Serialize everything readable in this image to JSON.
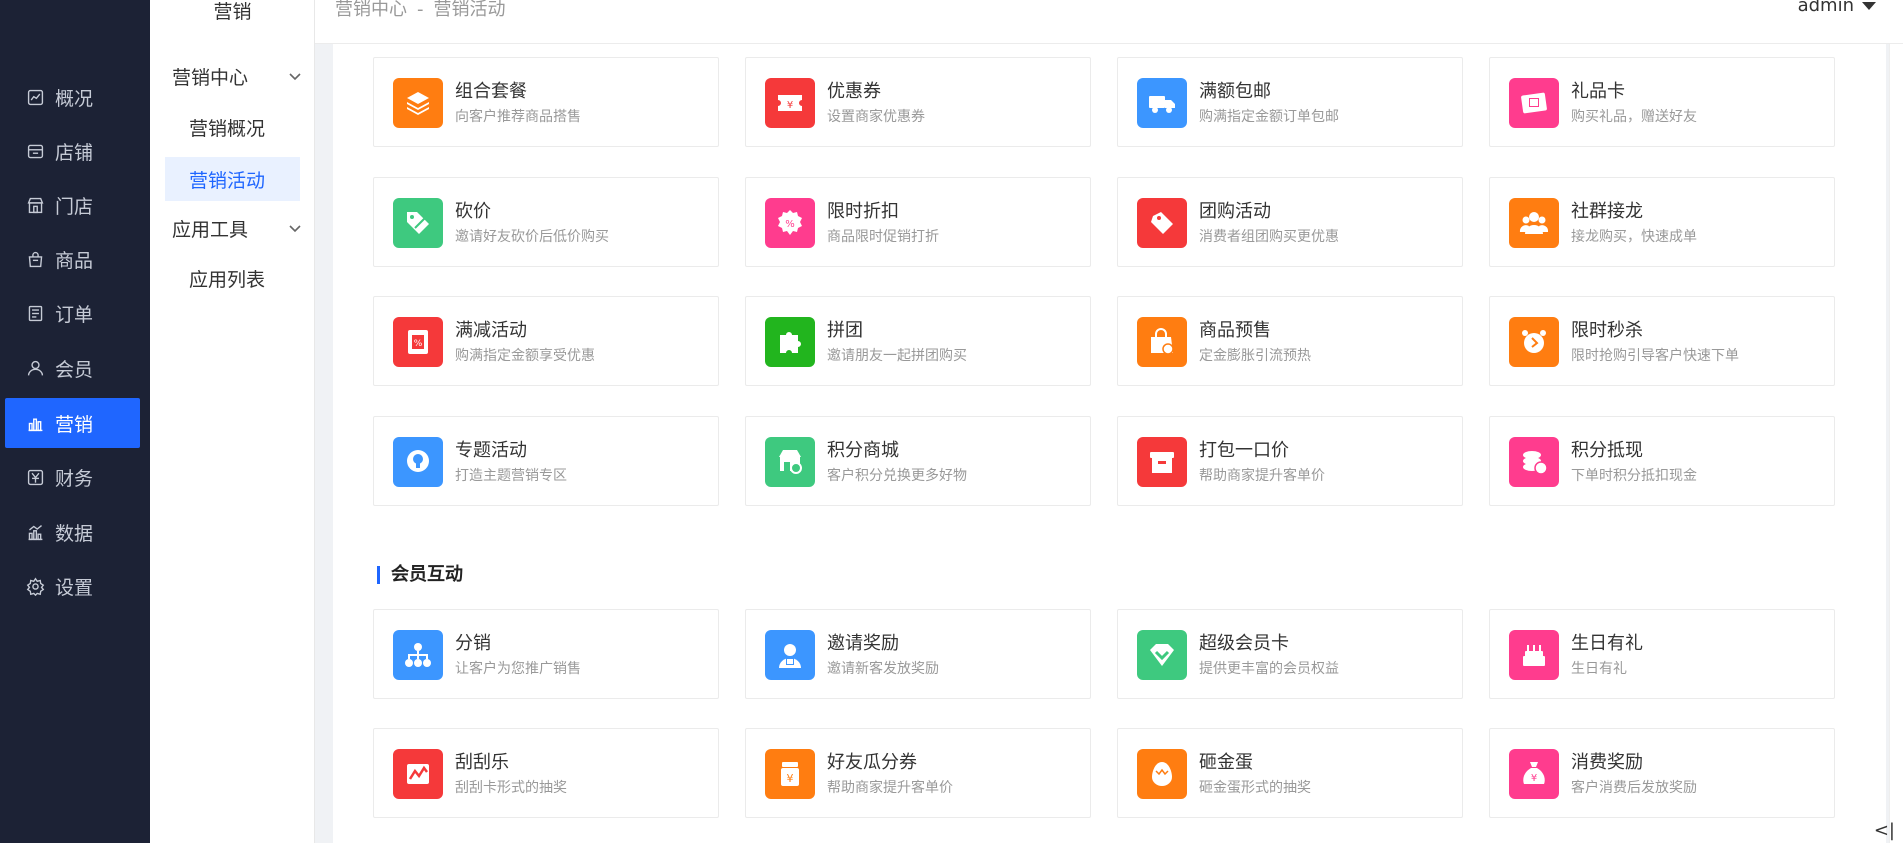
{
  "sidebar": {
    "items": [
      {
        "label": "概况",
        "icon": "chart-icon"
      },
      {
        "label": "店铺",
        "icon": "store-icon"
      },
      {
        "label": "门店",
        "icon": "shop-icon"
      },
      {
        "label": "商品",
        "icon": "bag-icon"
      },
      {
        "label": "订单",
        "icon": "order-icon"
      },
      {
        "label": "会员",
        "icon": "user-icon"
      },
      {
        "label": "营销",
        "icon": "bar-chart-icon"
      },
      {
        "label": "财务",
        "icon": "yen-icon"
      },
      {
        "label": "数据",
        "icon": "data-icon"
      },
      {
        "label": "设置",
        "icon": "gear-icon"
      }
    ],
    "active_index": 6
  },
  "subnav": {
    "title": "营销",
    "group1": "营销中心",
    "group1_items": [
      "营销概况",
      "营销活动"
    ],
    "group2": "应用工具",
    "group2_items": [
      "应用列表"
    ]
  },
  "header": {
    "crumb1": "营销中心",
    "sep": "-",
    "crumb2": "营销活动",
    "user": "admin"
  },
  "activities": [
    {
      "title": "组合套餐",
      "desc": "向客户推荐商品搭售",
      "color": "#ff7d11",
      "icon": "layers-icon"
    },
    {
      "title": "优惠券",
      "desc": "设置商家优惠券",
      "color": "#f5393a",
      "icon": "coupon-icon"
    },
    {
      "title": "满额包邮",
      "desc": "购满指定金额订单包邮",
      "color": "#3c96ff",
      "icon": "truck-icon"
    },
    {
      "title": "礼品卡",
      "desc": "购买礼品，赠送好友",
      "color": "#ff3c8e",
      "icon": "gift-card-icon"
    },
    {
      "title": "砍价",
      "desc": "邀请好友砍价后低价购买",
      "color": "#3ec97f",
      "icon": "tag-cut-icon"
    },
    {
      "title": "限时折扣",
      "desc": "商品限时促销打折",
      "color": "#ff3c8e",
      "icon": "discount-icon"
    },
    {
      "title": "团购活动",
      "desc": "消费者组团购买更优惠",
      "color": "#f5393a",
      "icon": "tags-icon"
    },
    {
      "title": "社群接龙",
      "desc": "接龙购买，快速成单",
      "color": "#ff7d11",
      "icon": "group-icon"
    },
    {
      "title": "满减活动",
      "desc": "购满指定金额享受优惠",
      "color": "#f5393a",
      "icon": "percent-ticket-icon"
    },
    {
      "title": "拼团",
      "desc": "邀请朋友一起拼团购买",
      "color": "#22b51e",
      "icon": "puzzle-icon"
    },
    {
      "title": "商品预售",
      "desc": "定金膨胀引流预热",
      "color": "#ff7d11",
      "icon": "presale-icon"
    },
    {
      "title": "限时秒杀",
      "desc": "限时抢购引导客户快速下单",
      "color": "#ff7d11",
      "icon": "alarm-icon"
    },
    {
      "title": "专题活动",
      "desc": "打造主题营销专区",
      "color": "#3c96ff",
      "icon": "bulb-icon"
    },
    {
      "title": "积分商城",
      "desc": "客户积分兑换更多好物",
      "color": "#3ec97f",
      "icon": "points-store-icon"
    },
    {
      "title": "打包一口价",
      "desc": "帮助商家提升客单价",
      "color": "#f5393a",
      "icon": "box-icon"
    },
    {
      "title": "积分抵现",
      "desc": "下单时积分抵扣现金",
      "color": "#ff3c8e",
      "icon": "coins-icon"
    }
  ],
  "member_section": {
    "title": "会员互动",
    "items": [
      {
        "title": "分销",
        "desc": "让客户为您推广销售",
        "color": "#3c96ff",
        "icon": "network-icon"
      },
      {
        "title": "邀请奖励",
        "desc": "邀请新客发放奖励",
        "color": "#3c96ff",
        "icon": "invite-icon"
      },
      {
        "title": "超级会员卡",
        "desc": "提供更丰富的会员权益",
        "color": "#3ec97f",
        "icon": "diamond-icon"
      },
      {
        "title": "生日有礼",
        "desc": "生日有礼",
        "color": "#ff3c8e",
        "icon": "cake-icon"
      },
      {
        "title": "刮刮乐",
        "desc": "刮刮卡形式的抽奖",
        "color": "#f5393a",
        "icon": "scratch-icon"
      },
      {
        "title": "好友瓜分券",
        "desc": "帮助商家提升客单价",
        "color": "#ff7d11",
        "icon": "split-coupon-icon"
      },
      {
        "title": "砸金蛋",
        "desc": "砸金蛋形式的抽奖",
        "color": "#ff7d11",
        "icon": "egg-icon"
      },
      {
        "title": "消费奖励",
        "desc": "客户消费后发放奖励",
        "color": "#ff3c8e",
        "icon": "money-bag-icon"
      }
    ]
  },
  "collapse_label": "<|"
}
